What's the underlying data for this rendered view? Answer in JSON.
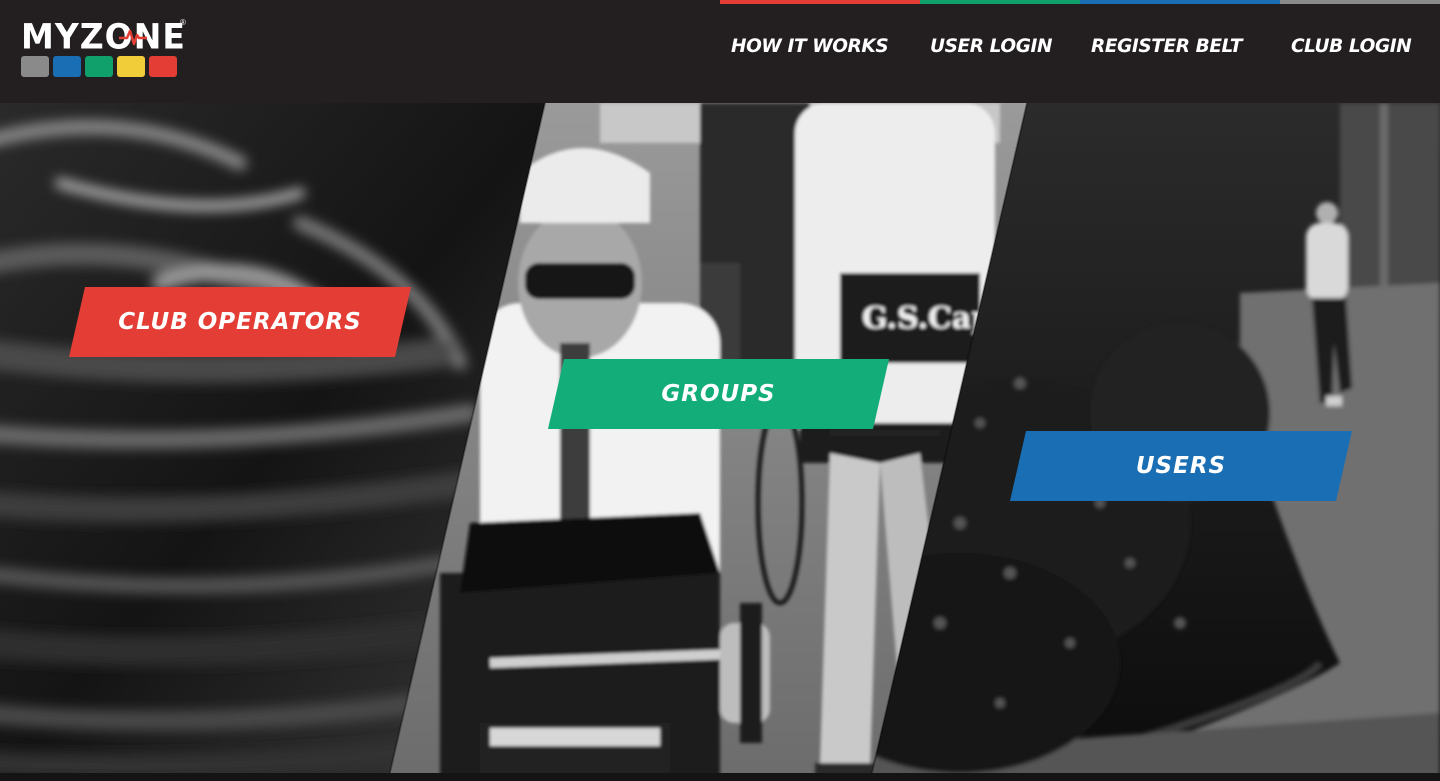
{
  "header": {
    "logo": {
      "text": "MYZONE",
      "registered_mark": "®",
      "square_colors": [
        "#8a8a8a",
        "#1a6fb4",
        "#0fa06b",
        "#f2cd3a",
        "#e43d35"
      ],
      "pulse_color": "#e43d35"
    },
    "accent_strip_colors": [
      "#e43d35",
      "#0fa06b",
      "#1a6fb4",
      "#8a8a8a"
    ],
    "nav": [
      {
        "label": "HOW IT WORKS"
      },
      {
        "label": "USER LOGIN"
      },
      {
        "label": "REGISTER BELT"
      },
      {
        "label": "CLUB LOGIN"
      }
    ]
  },
  "panels": [
    {
      "button_label": "CLUB OPERATORS",
      "button_color": "#e43d35",
      "photo_description_icon": "spin-bike-handlebars-photo"
    },
    {
      "button_label": "GROUPS",
      "button_color": "#12ad78",
      "photo_description_icon": "cyclists-photo"
    },
    {
      "button_label": "USERS",
      "button_color": "#1a6fb4",
      "photo_description_icon": "runner-photo"
    }
  ]
}
